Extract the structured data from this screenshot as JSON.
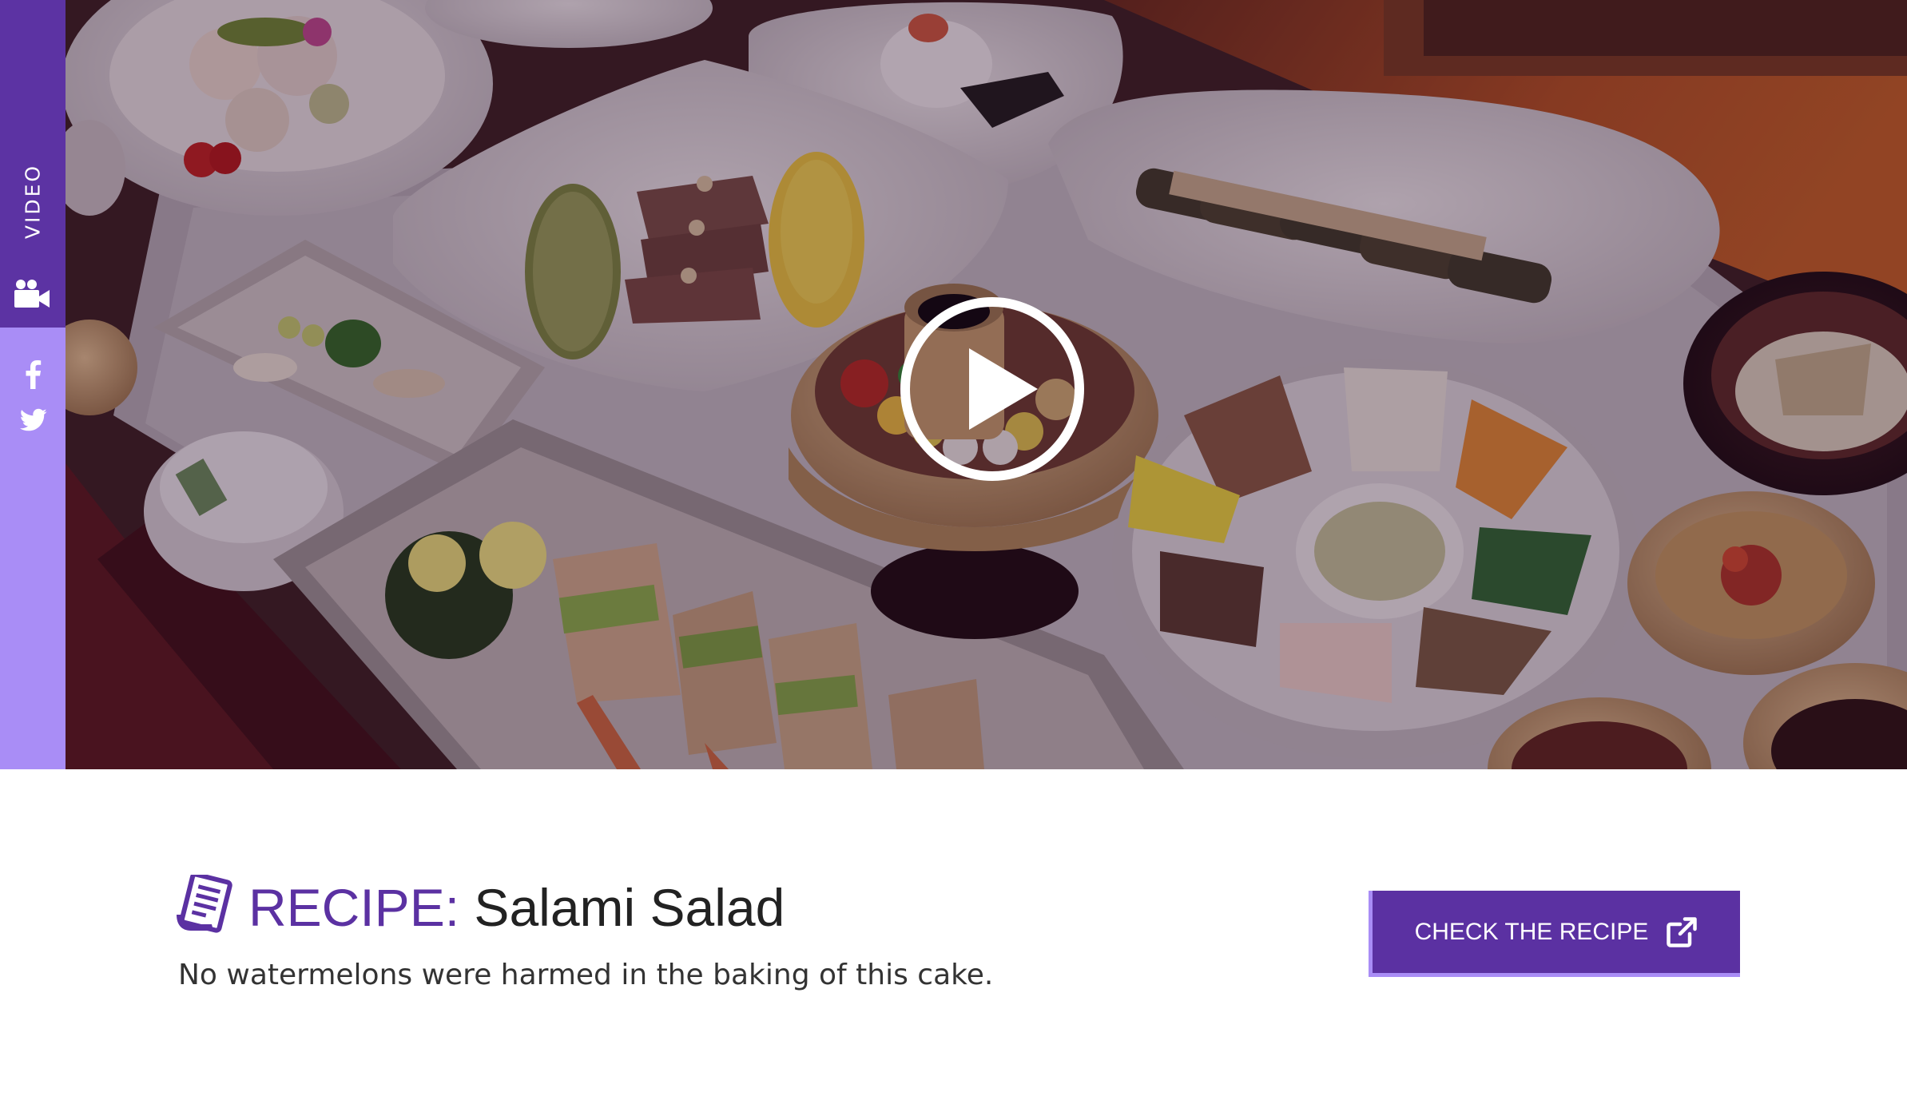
{
  "side_rail": {
    "video_label": "VIDEO",
    "video_icon": "video-camera-icon",
    "social_icons": [
      "facebook-icon",
      "twitter-icon"
    ],
    "colors": {
      "video_bg": "#5c33a3",
      "social_bg": "#a98df6"
    }
  },
  "video": {
    "play_icon": "play-icon"
  },
  "recipe": {
    "icon": "recipe-document-icon",
    "prefix": "RECIPE:",
    "title": "Salami Salad",
    "description": "No watermelons were harmed in the baking of this cake.",
    "cta_label": "CHECK THE RECIPE",
    "cta_icon": "external-link-icon"
  },
  "colors": {
    "accent": "#5b31a2",
    "accent_light": "#a98df6",
    "text_dark": "#222222"
  }
}
